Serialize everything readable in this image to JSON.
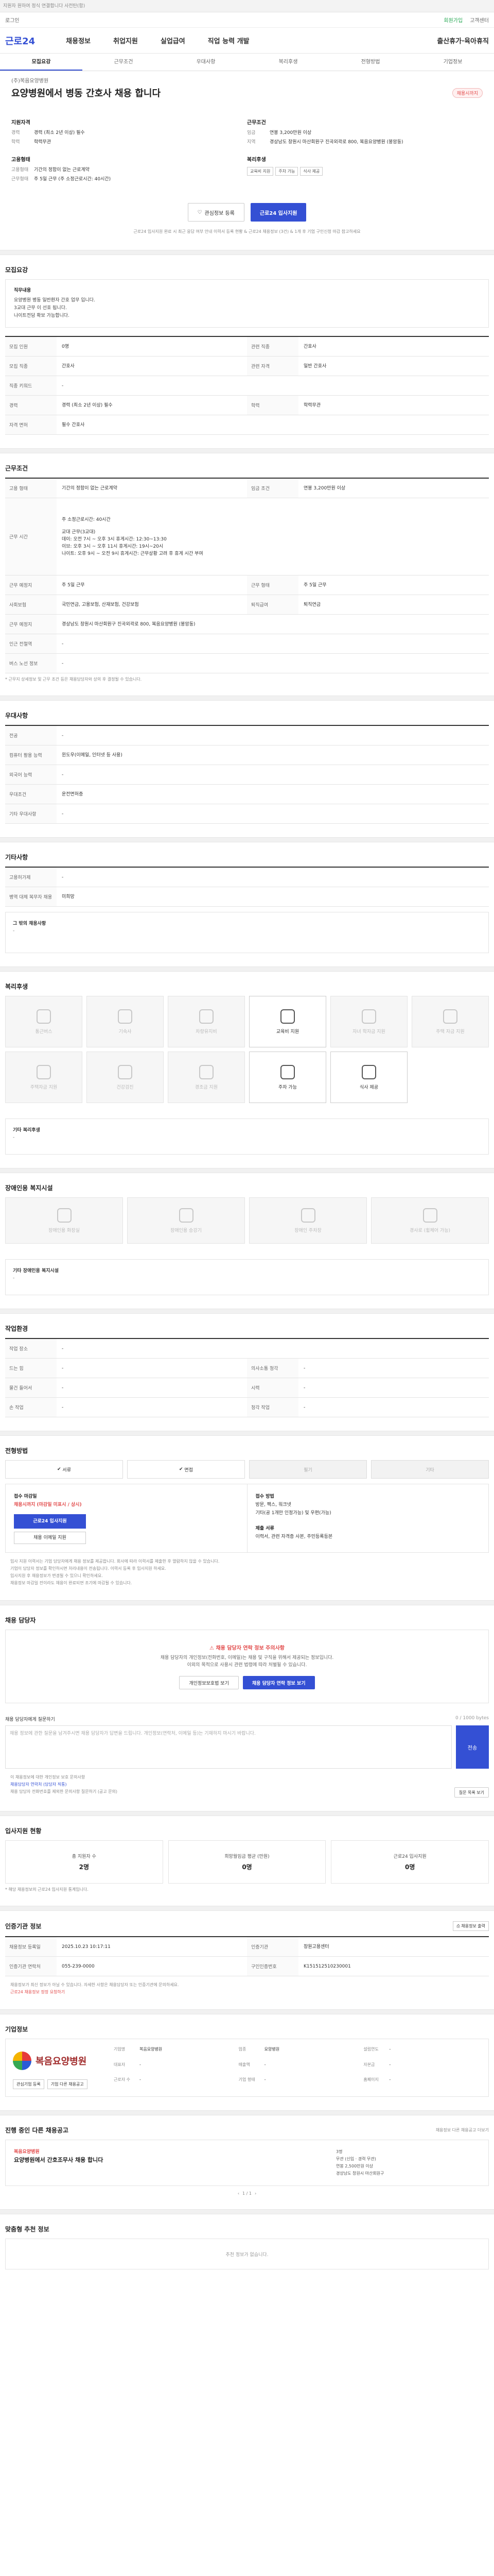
{
  "notice": "지원자 원하여 정식 연결합니다 사전탄(함)",
  "topbar": {
    "left": "로그인",
    "links": [
      "회원가입",
      "고객센터"
    ]
  },
  "gnb": {
    "logo": "근로24",
    "menu": [
      "채용정보",
      "취업지원",
      "실업급여",
      "직업 능력 개발",
      "출산휴가·육아휴직"
    ]
  },
  "tabs": [
    "모집요강",
    "근무조건",
    "우대사항",
    "복리후생",
    "전형방법",
    "기업정보"
  ],
  "head": {
    "company": "(주)복음요양병원",
    "title": "요양병원에서 병동 간호사 채용 합니다",
    "badge": "채용시까지",
    "left_title": "지원자격",
    "left_items": [
      {
        "k": "경력",
        "v": "경력 (최소 2년 이상) 필수"
      },
      {
        "k": "학력",
        "v": "학력무관"
      }
    ],
    "left_sub_title": "고용형태",
    "left_sub_items": [
      {
        "k": "고용형태",
        "v": "기간의 정함이 없는 근로계약"
      },
      {
        "k": "근무형태",
        "v": "주 5일 근무 (주 소정근로시간: 40시간)"
      }
    ],
    "right_title": "근무조건",
    "right_items": [
      {
        "k": "임금",
        "v": "연봉 3,200만원 이상"
      },
      {
        "k": "지역",
        "v": "경상남도 창원시 마산회원구 진곡외곽로 800, 복음요양병원 (봉암동)"
      }
    ],
    "right_sub_title": "복리후생",
    "tags": [
      "교육비 지원",
      "주차 가능",
      "식사 제공"
    ],
    "btn_fav": "관심정보 등록",
    "btn_apply": "근로24 입사지원",
    "note": "근로24 입사지원 완료 시 최근 응답 여부 안내 이력서 등록 현황 & 근로24 채용정보 (3건) & 1개 후 기업 구인신청 마감 참고하세요"
  },
  "recruit": {
    "title": "모집요강",
    "box_title": "직무내용",
    "box_lines": [
      "요양병원 병동 일반환자 간호 업무 입니다.",
      "3교대 근무 이 선호 됩니다.",
      "나이트전담 확보 가능합니다."
    ],
    "rows": [
      [
        {
          "k": "모집 인원",
          "v": "0명"
        },
        {
          "k": "관련 직종",
          "v": "간호사"
        }
      ],
      [
        {
          "k": "모집 직종",
          "v": "간호사"
        },
        {
          "k": "관련 자격",
          "v": "일반 간호사"
        }
      ],
      [
        {
          "k": "직종 키워드",
          "v": "-"
        }
      ],
      [
        {
          "k": "경력",
          "v": "경력 (최소 2년 이상) 필수"
        },
        {
          "k": "학력",
          "v": "학력무관"
        }
      ],
      [
        {
          "k": "자격 면허",
          "v": "필수 간호사"
        }
      ]
    ]
  },
  "work": {
    "title": "근무조건",
    "rows": [
      [
        {
          "k": "고용 형태",
          "v": "기간의 정함이 없는 근로계약"
        },
        {
          "k": "임금 조건",
          "v": "연봉 3,200만원 이상"
        }
      ],
      [
        {
          "k": "근무 시간",
          "v": "주 소정근로시간: 40시간"
        }
      ],
      [
        {
          "k": "",
          "v": "(근무형태) 교대근무 (3교대)"
        }
      ],
      [
        {
          "k": "",
          "v": "(근무시간) 1일 7~8시간 / 주 소정근로시간 40시간"
        }
      ],
      [
        {
          "k": "근무 예정지",
          "v": "주 5일 근무"
        },
        {
          "k": "근무 형태",
          "v": "주 5일 근무"
        }
      ],
      [
        {
          "k": "사회보험",
          "v": "국민연금, 고용보험, 산재보험, 건강보험"
        },
        {
          "k": "퇴직급여",
          "v": "퇴직연금"
        }
      ],
      [
        {
          "k": "근무 예정지",
          "v": "경상남도 창원시 마산회원구 진곡외곽로 800, 복음요양병원 (봉암동)"
        }
      ],
      [
        {
          "k": "인근 전철역",
          "v": "-"
        }
      ],
      [
        {
          "k": "버스 노선 정보",
          "v": "-"
        }
      ]
    ],
    "schedule": [
      "주 소정근로시간: 40시간",
      "교대 근무(3교대)",
      "데이: 오전 7시 ~ 오후 3시  휴게시간: 12:30~13:30",
      "이브: 오후 3시 ~ 오후 11시  휴게시간: 19시~20시",
      "나이트: 오후 9시 ~ 오전 9시  휴게시간: 근무상황 고려 후 휴게 시간 부여"
    ],
    "note": "* 근무지 상세정보 및 근무 조건 등은 채용담당자와 상의 후 결정될 수 있습니다."
  },
  "pref": {
    "title": "우대사항",
    "rows": [
      [
        {
          "k": "전공",
          "v": "-"
        }
      ],
      [
        {
          "k": "컴퓨터 활용 능력",
          "v": "윈도우(이메일, 인터넷 등 사용)"
        }
      ],
      [
        {
          "k": "외국어 능력",
          "v": "-"
        }
      ],
      [
        {
          "k": "우대조건",
          "v": "운전면허증"
        }
      ],
      [
        {
          "k": "기타 우대사항",
          "v": "-"
        }
      ]
    ]
  },
  "other": {
    "title": "기타사항",
    "rows": [
      [
        {
          "k": "고용허가제",
          "v": "-"
        }
      ],
      [
        {
          "k": "병역 대체 복무자 채용",
          "v": "미희망"
        }
      ]
    ],
    "extra_label": "그 밖의 채용사항",
    "extra_val": "-"
  },
  "welfare": {
    "title": "복리후생",
    "items": [
      {
        "label": "통근버스",
        "on": false
      },
      {
        "label": "기숙사",
        "on": false
      },
      {
        "label": "차량유지비",
        "on": false
      },
      {
        "label": "교육비 지원",
        "on": true
      },
      {
        "label": "자녀 학자금 지원",
        "on": false
      },
      {
        "label": "주택 자금 지원",
        "on": false
      },
      {
        "label": "주택자금 지원",
        "on": false
      },
      {
        "label": "건강검진",
        "on": false
      },
      {
        "label": "경조금 지원",
        "on": false
      },
      {
        "label": "주차 가능",
        "on": true
      },
      {
        "label": "식사 제공",
        "on": true
      }
    ],
    "extra_label": "기타 복리후생",
    "extra_val": "-"
  },
  "disability": {
    "title": "장애인용 복지시설",
    "items": [
      "장애인용 화장실",
      "장애인용 승강기",
      "장애인 주차장",
      "경사로 (휠체어 가능)"
    ],
    "extra_label": "기타 장애인용 복지시설",
    "extra_val": "-"
  },
  "conditions": {
    "title": "작업환경",
    "rows": [
      [
        {
          "k": "작업 장소",
          "v": "-"
        }
      ],
      [
        {
          "k": "드는 힘",
          "v": "-"
        },
        {
          "k": "의사소통 청각",
          "v": "-"
        }
      ],
      [
        {
          "k": "물건 들어서",
          "v": "-"
        },
        {
          "k": "시력",
          "v": "-"
        }
      ],
      [
        {
          "k": "손 작업",
          "v": "-"
        },
        {
          "k": "청각 작업",
          "v": "-"
        }
      ]
    ]
  },
  "process": {
    "title": "전형방법",
    "steps": [
      {
        "label": "서류",
        "on": true
      },
      {
        "label": "면접",
        "on": true
      },
      {
        "label": "필기",
        "on": false
      },
      {
        "label": "기타",
        "on": false
      }
    ],
    "left_label": "접수 마감일",
    "left_val": "채용시까지 (마감일 미표시 / 상시)",
    "apply_btn": "근로24 입사지원",
    "email_btn": "채용 이메일 지원",
    "right_label": "접수 방법",
    "right_items": [
      "방문, 팩스, 워크넷",
      "기타(공 1개만 인정가능) 및 우편(가능)"
    ],
    "doc_label": "제출 서류",
    "doc_val": "이력서, 관련 자격증 사본, 주민등록등본",
    "bullets": [
      "입사 지원 이력서는 기업 담당자에게 채용 정보를 제공합니다. 회사에 따라 이력서를 제출한 후 열람하지 않을 수 있습니다.",
      "기업이 담당자 정보를 확인하시면 처리내용이 전송됩니다. 이력서 등록 후 입사지원 하세요.",
      "입사지원 후 채용정보가 변경될 수 있으니 확인하세요.",
      "채용정보 마감일 전이라도 채용이 완료되면 조기에 마감될 수 있습니다."
    ]
  },
  "manager": {
    "title": "채용 담당자",
    "alert": "채용 담당자 연락 정보 주의사항",
    "lines": [
      "채용 담당자의 개인정보(전화번호, 이메일)는 채용 및 구직을 위해서 제공되는 정보입니다.",
      "이외의 목적으로 사용시 관련 법령에 따라 처벌될 수 있습니다."
    ],
    "btn1": "개인정보보호법 보기",
    "btn2": "채용 담당자 연락 정보 보기"
  },
  "question": {
    "title": "채용 담당자에게 질문하기",
    "count": "0 / 1000 bytes",
    "placeholder": "채용 정보에 관한 질문을 남겨주시면 채용 담당자가 답변을 드립니다. 개인정보(연락처, 이메일 등)는 기재하지 마시기 바랍니다.",
    "send": "전송",
    "bullets": [
      "이 채용정보에 대한 개인정보 보호 문의사항",
      "채용담당자 연락처 (담당자 직통)",
      "채용 담당자 전화번호를 제외한 문의사항 질문하기 (공고 문의)"
    ],
    "list_btn": "질문 목록 보기"
  },
  "stats": {
    "title": "입사지원 현황",
    "items": [
      {
        "label": "총 지원자 수",
        "val": "2명"
      },
      {
        "label": "희망월임금 평균 (만원)",
        "val": "0명"
      },
      {
        "label": "근로24 입사지원",
        "val": "0명"
      }
    ],
    "note": "* 해당 채용정보의 근로24 입사지원 통계입니다."
  },
  "info": {
    "title": "인증기관 정보",
    "print": "채용정보 출력",
    "rows": [
      [
        {
          "k": "채용정보 등록일",
          "v": "2025.10.23 10:17:11"
        },
        {
          "k": "인증기관",
          "v": "창원고용센터"
        }
      ],
      [
        {
          "k": "인증기관 연락처",
          "v": "055-239-0000"
        },
        {
          "k": "구인인증번호",
          "v": "K151512510230001"
        }
      ]
    ],
    "note1": "채용정보가 최신 정보가 아닐 수 있습니다. 자세한 사항은 채용담당자 또는 인증기관에 문의하세요.",
    "note2": "근로24 채용정보 정정 요청하기"
  },
  "company": {
    "title": "기업정보",
    "name": "복음요양병원",
    "fields": [
      {
        "k": "기업명",
        "v": "복음요양병원"
      },
      {
        "k": "업종",
        "v": "요양병원"
      },
      {
        "k": "설립연도",
        "v": "-"
      },
      {
        "k": "대표자",
        "v": "-"
      },
      {
        "k": "매출액",
        "v": "-"
      },
      {
        "k": "자본금",
        "v": "-"
      },
      {
        "k": "근로자 수",
        "v": "-"
      },
      {
        "k": "기업 형태",
        "v": "-"
      },
      {
        "k": "홈페이지",
        "v": "-"
      }
    ],
    "btns": [
      "관심기업 등록",
      "기업 다른 채용공고"
    ]
  },
  "others": {
    "title": "진행 중인 다른 채용공고",
    "more": "채용정보 다른 채용공고 더보기",
    "co": "복음요양병원",
    "tt": "요양병원에서 간호조무사 채용 합니다",
    "r": [
      "3명",
      "무관 (신입 · 경력 무관)",
      "연봉 2,500만원 이상",
      "경상남도 창원시 마산회원구"
    ],
    "pager": "1 / 1"
  },
  "recommend": {
    "title": "맞춤형 추천 정보",
    "empty": "추천 정보가 없습니다."
  }
}
